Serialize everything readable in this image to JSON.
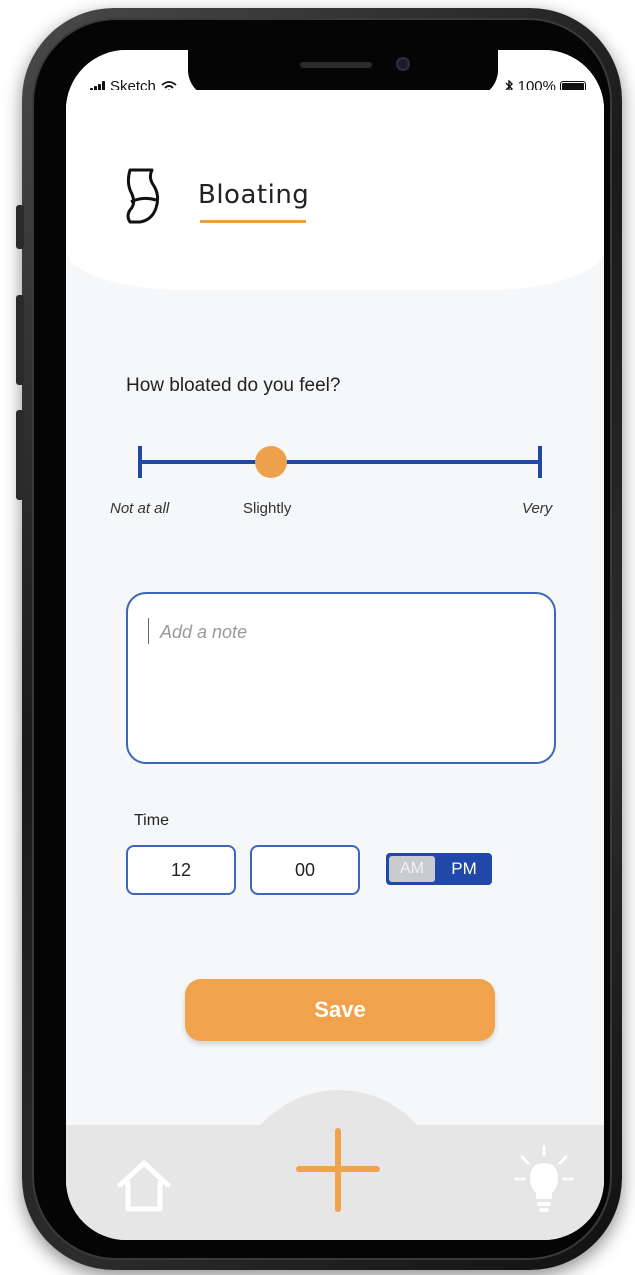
{
  "status_bar": {
    "carrier": "Sketch",
    "battery_percent": "100%",
    "battery_level": 1.0
  },
  "header": {
    "title": "Bloating",
    "icon": "stomach-icon"
  },
  "question": "How bloated do you feel?",
  "slider": {
    "labels": [
      "Not at all",
      "Slightly",
      "Very"
    ],
    "selected": "Slightly",
    "value_fraction": 0.33,
    "track_color": "#1f48a8",
    "knob_color": "#eda14c"
  },
  "note": {
    "placeholder": "Add a note"
  },
  "time": {
    "label": "Time",
    "hour": "12",
    "minute": "00",
    "am_label": "AM",
    "pm_label": "PM",
    "selected_period": "PM"
  },
  "save_label": "Save",
  "nav": {
    "items": [
      "home-icon",
      "add-icon",
      "lightbulb-icon"
    ],
    "accent": "#f0a24d"
  }
}
